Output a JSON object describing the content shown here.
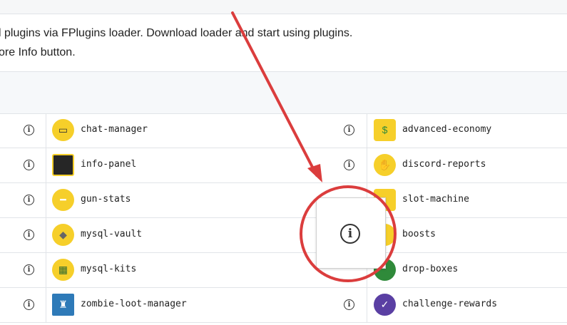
{
  "intro": {
    "line1": "l plugins via FPlugins loader. Download loader and start using plugins.",
    "line2": "ore Info button."
  },
  "rows": [
    {
      "left_plugin": {
        "name": "chat-manager",
        "icon": "chat-bubble-icon"
      },
      "right_plugin": {
        "name": "advanced-economy",
        "icon": "money-icon"
      }
    },
    {
      "left_plugin": {
        "name": "info-panel",
        "icon": "panel-icon"
      },
      "right_plugin": {
        "name": "discord-reports",
        "icon": "hand-icon"
      }
    },
    {
      "left_plugin": {
        "name": "gun-stats",
        "icon": "gun-icon"
      },
      "right_plugin": {
        "name": "slot-machine",
        "icon": "slot-machine-icon"
      }
    },
    {
      "left_plugin": {
        "name": "mysql-vault",
        "icon": "vault-icon"
      },
      "right_plugin": {
        "name": "boosts",
        "icon": "boost-icon"
      }
    },
    {
      "left_plugin": {
        "name": "mysql-kits",
        "icon": "kits-icon"
      },
      "right_plugin": {
        "name": "drop-boxes",
        "icon": "drop-box-icon"
      }
    },
    {
      "left_plugin": {
        "name": "zombie-loot-manager",
        "icon": "zombie-icon"
      },
      "right_plugin": {
        "name": "challenge-rewards",
        "icon": "check-badge-icon"
      }
    }
  ],
  "info_button_glyph": "i",
  "colors": {
    "annotation_red": "#db3d3d",
    "plugin_yellow": "#f6cf2a"
  }
}
